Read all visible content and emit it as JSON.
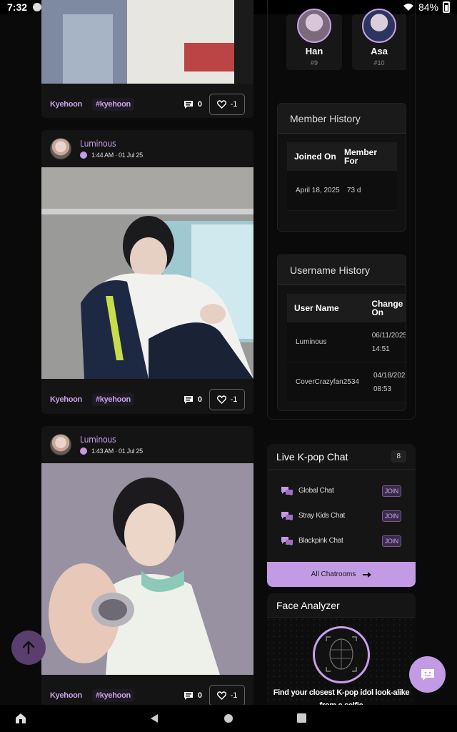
{
  "status": {
    "time": "7:32",
    "battery": "84%"
  },
  "posts": [
    {
      "author": "Kyehoon",
      "tag": "#kyehoon",
      "comments": "0",
      "likes": "-1"
    },
    {
      "user": "Luminous",
      "meta": "1:44 AM · 01 Jul 25",
      "author": "Kyehoon",
      "tag": "#kyehoon",
      "comments": "0",
      "likes": "-1"
    },
    {
      "user": "Luminous",
      "meta": "1:43 AM · 01 Jul 25",
      "author": "Kyehoon",
      "tag": "#kyehoon",
      "comments": "0",
      "likes": "-1"
    }
  ],
  "members": [
    {
      "name": "Han",
      "rank": "#9"
    },
    {
      "name": "Asa",
      "rank": "#10"
    }
  ],
  "member_history": {
    "title": "Member History",
    "col1": "Joined On",
    "col2": "Member For",
    "joined": "April 18, 2025",
    "for": "73 d"
  },
  "username_history": {
    "title": "Username History",
    "col1": "User Name",
    "col2": "Change On",
    "rows": [
      {
        "name": "Luminous",
        "date": "06/11/2025",
        "time": "14:51"
      },
      {
        "name": "CoverCrazyfan2534",
        "date": "04/18/202",
        "time": "08:53"
      }
    ]
  },
  "chat": {
    "title": "Live K-pop Chat",
    "count": "8",
    "rooms": [
      "Global Chat",
      "Stray Kids Chat",
      "Blackpink Chat"
    ],
    "join_label": "JOIN",
    "all_label": "All Chatrooms"
  },
  "face": {
    "title": "Face Analyzer",
    "text_line1": "Find your closest K-pop idol look-alike",
    "text_line2": "from a selfie"
  },
  "colors": {
    "accent": "#c39ae4",
    "bg": "#0a0a0a",
    "card": "#141414"
  }
}
